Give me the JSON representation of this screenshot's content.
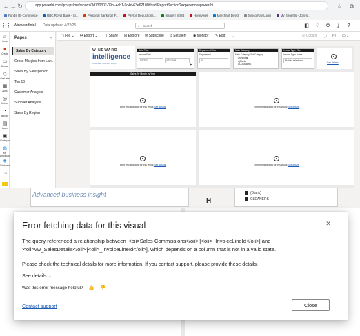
{
  "browser": {
    "url": "app.powerbi.com/groups/me/reports/3d730302-09bf-4db1-9d4d-63e62100bbad/ReportSection?experience=power-bi",
    "bookmarks": [
      "Funds | E-Commerce",
      "RBC Royal Bank - Si...",
      "Personal Banking | F...",
      "Payroll Deductions...",
      "Insurer| WSIB",
      "Honeywell",
      "Merchant Direct",
      "Sysco Pay Login",
      "My Benefits - Johns..."
    ]
  },
  "header": {
    "workspace": "WindwardIntel",
    "updated": "Data updated 4/22/25",
    "search_placeholder": "Search"
  },
  "rail": {
    "items": [
      "Home",
      "Create",
      "Browse",
      "OneLake",
      "Apps",
      "Metrics",
      "Monitor",
      "Learn",
      "Workspaces",
      "My workspace",
      "WindwardIntel",
      "More"
    ]
  },
  "pages": {
    "title": "Pages",
    "items": [
      "Sales By Category",
      "Gross Margins from Lan...",
      "Sales By Salesperson",
      "Top 10",
      "Customer Analysis",
      "Supplier Analysis",
      "Sales By Region"
    ]
  },
  "toolbar": {
    "items": [
      "File",
      "Export",
      "Share",
      "Explore",
      "Subscribe",
      "Set alert",
      "Monitor",
      "Edit",
      "..."
    ],
    "copilot": "Copilot"
  },
  "canvas": {
    "logo_top": "WINDWARD",
    "logo_bottom": "intelligence",
    "logo_tagline": "Advanced business insight",
    "slicers": {
      "date": {
        "title": "Date Filter",
        "label": "Invoice Date",
        "from": "1/1/2021",
        "to": "4/22/2025"
      },
      "department": {
        "title": "Department Filter",
        "label": "Department",
        "value": "All"
      },
      "category": {
        "title": "Main Category",
        "label": "Main Category, SubCategory",
        "options": [
          "Select all",
          "(Blank)",
          "CLEANERS"
        ]
      },
      "invoice_type": {
        "title": "Invoice Type Filter",
        "label": "Invoice Type Name",
        "value": "Multiple selections"
      }
    },
    "see_details": "See details",
    "chart_title": "Sales By Month by Year",
    "error_text": "Error fetching data for this visual",
    "error_link": "See details"
  },
  "background_zoom": {
    "blank_label": "(Blank)",
    "cleaners_label": "CLEANERS",
    "logo_tagline": "Advanced business insight"
  },
  "dialog": {
    "title": "Error fetching data for this visual",
    "message_line1": "The query referenced a relationship between '<oii>Sales Commissions</oii>'[<oii>_InvoiceLineId</oii>] and",
    "message_line2": "'<oii>vw_SalesDetails</oii>'[<oii>_InvoiceLineId</oii>], which depends on a column that is not in a valid state.",
    "technical_note": "Please check the technical details for more information. If you contact support, please provide these details.",
    "see_details": "See details",
    "helpful_question": "Was this error message helpful?",
    "contact_support": "Contact support",
    "close_button": "Close"
  }
}
